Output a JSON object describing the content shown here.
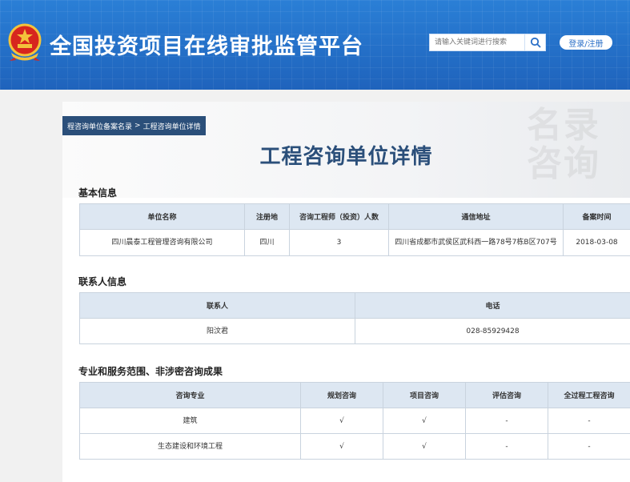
{
  "header": {
    "site_title": "全国投资项目在线审批监管平台",
    "search_placeholder": "请输入关键词进行搜索",
    "login_label": "登录/注册",
    "brand_color": "#1f63bc"
  },
  "breadcrumb": {
    "items": [
      "程咨询单位备案名录",
      "工程咨询单位详情"
    ],
    "separator": ">"
  },
  "page_title": "工程咨询单位详情",
  "watermark": {
    "line1": "名录",
    "line2": "咨询"
  },
  "basic_info": {
    "title": "基本信息",
    "headers": [
      "单位名称",
      "注册地",
      "咨询工程师（投资）人数",
      "通信地址",
      "备案时间"
    ],
    "rows": [
      [
        "四川晨泰工程管理咨询有限公司",
        "四川",
        "3",
        "四川省成都市武侯区武科西一路78号7栋B区707号",
        "2018-03-08"
      ]
    ]
  },
  "contact_info": {
    "title": "联系人信息",
    "headers": [
      "联系人",
      "电话"
    ],
    "rows": [
      [
        "阳汶君",
        "028-85929428"
      ]
    ]
  },
  "scope_info": {
    "title": "专业和服务范围、非涉密咨询成果",
    "headers": [
      "咨询专业",
      "规划咨询",
      "项目咨询",
      "评估咨询",
      "全过程工程咨询"
    ],
    "rows": [
      [
        "建筑",
        "√",
        "√",
        "-",
        "-"
      ],
      [
        "生态建设和环境工程",
        "√",
        "√",
        "-",
        "-"
      ]
    ]
  }
}
